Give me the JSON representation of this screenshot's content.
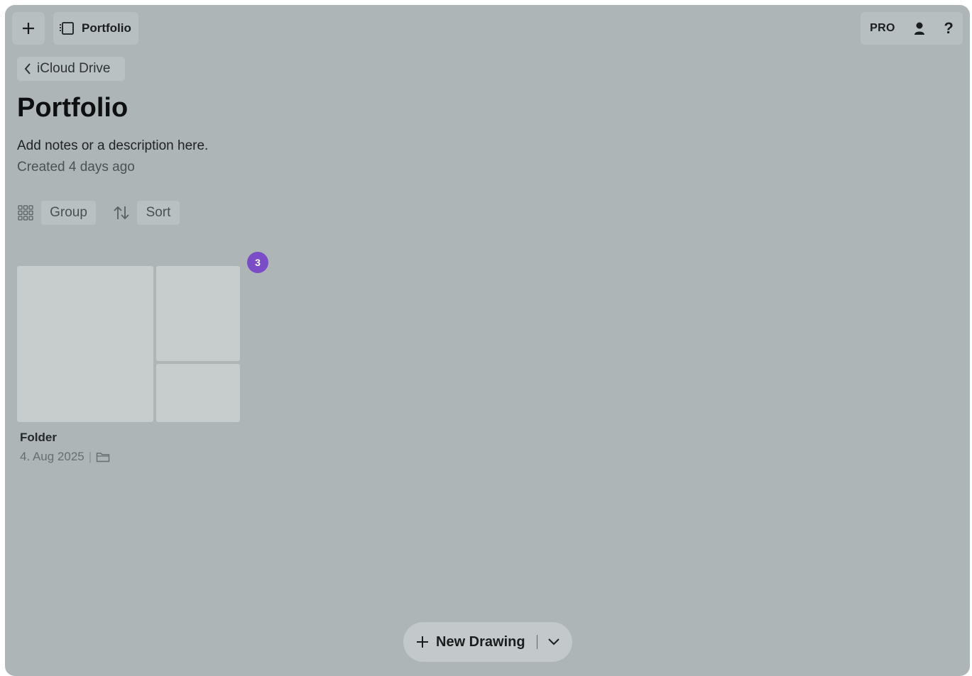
{
  "header": {
    "folder_label": "Portfolio",
    "pro_label": "PRO",
    "help_label": "?"
  },
  "nav": {
    "back_label": "iCloud Drive"
  },
  "page": {
    "title": "Portfolio",
    "description": "Add notes or a description here.",
    "created": "Created 4 days ago"
  },
  "toolbar": {
    "group_label": "Group",
    "sort_label": "Sort"
  },
  "items": [
    {
      "name": "Folder",
      "date": "4. Aug 2025",
      "badge": "3"
    }
  ],
  "bottom": {
    "new_drawing_label": "New Drawing"
  },
  "colors": {
    "background": "#adb5b7",
    "badge": "#7b4cc8"
  }
}
